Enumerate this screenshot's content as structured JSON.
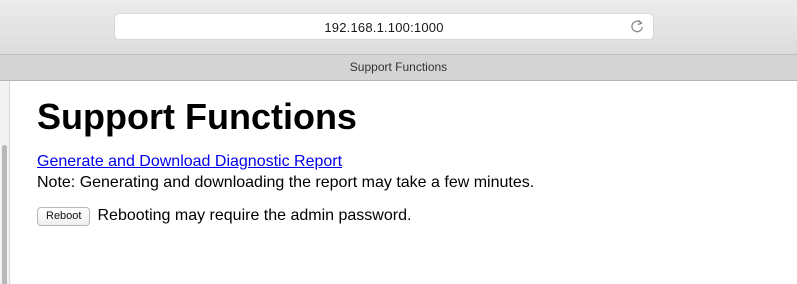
{
  "browser": {
    "address": "192.168.1.100:1000",
    "tab_title": "Support Functions"
  },
  "page": {
    "title": "Support Functions",
    "report_link": "Generate and Download Diagnostic Report",
    "note": "Note: Generating and downloading the report may take a few minutes.",
    "reboot_button": "Reboot",
    "reboot_note": "Rebooting may require the admin password."
  },
  "icons": {
    "reload": "reload-icon"
  },
  "colors": {
    "link": "#0000ee",
    "toolbar": "#e4e4e4"
  }
}
